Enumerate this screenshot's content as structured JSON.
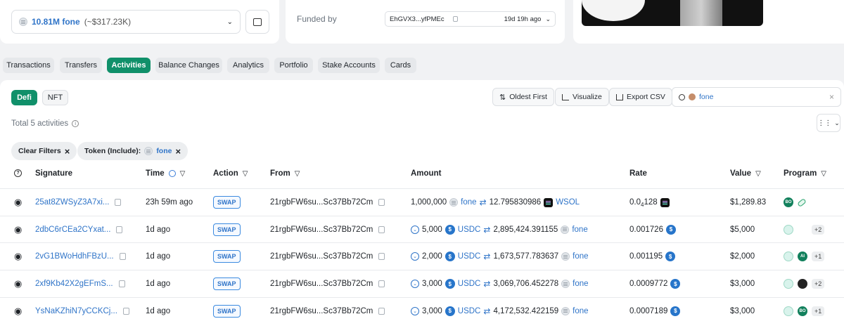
{
  "header": {
    "balance_amount": "10.81M fone",
    "balance_usd": "(~$317.23K)",
    "funded_by_label": "Funded by",
    "funded_by_address": "EhGVX3...yfPMEc",
    "funded_by_time": "19d 19h ago"
  },
  "tabs": [
    "Transactions",
    "Transfers",
    "Activities",
    "Balance Changes",
    "Analytics",
    "Portfolio",
    "Stake Accounts",
    "Cards"
  ],
  "subtabs": [
    "Defi",
    "NFT"
  ],
  "toolbar": {
    "oldest_first": "Oldest First",
    "visualize": "Visualize",
    "export_csv": "Export CSV",
    "search_value": "fone"
  },
  "summary": {
    "total": "Total 5 activities"
  },
  "filters": {
    "clear": "Clear Filters",
    "token_label": "Token (Include):",
    "token_value": "fone"
  },
  "columns": {
    "signature": "Signature",
    "time": "Time",
    "action": "Action",
    "from": "From",
    "amount": "Amount",
    "rate": "Rate",
    "value": "Value",
    "program": "Program"
  },
  "rows": [
    {
      "signature": "25at8ZWSyZ3A7xi...",
      "time": "23h 59m ago",
      "action": "SWAP",
      "from": "21rgbFW6su...Sc37Bb72Cm",
      "in_amount": "1,000,000",
      "in_token": "fone",
      "out_amount": "12.795830986",
      "out_token": "WSOL",
      "rate_main": "0.0",
      "rate_sub": "4",
      "rate_rest": "128",
      "value": "$1,289.83",
      "extra": "",
      "type": "sell"
    },
    {
      "signature": "2dbC6rCEa2CYxat...",
      "time": "1d ago",
      "action": "SWAP",
      "from": "21rgbFW6su...Sc37Bb72Cm",
      "in_amount": "5,000",
      "in_token": "USDC",
      "out_amount": "2,895,424.391155",
      "out_token": "fone",
      "rate_main": "0.001726",
      "rate_sub": "",
      "rate_rest": "",
      "value": "$5,000",
      "extra": "+2",
      "type": "buy"
    },
    {
      "signature": "2vG1BWoHdhFBzU...",
      "time": "1d ago",
      "action": "SWAP",
      "from": "21rgbFW6su...Sc37Bb72Cm",
      "in_amount": "2,000",
      "in_token": "USDC",
      "out_amount": "1,673,577.783637",
      "out_token": "fone",
      "rate_main": "0.001195",
      "rate_sub": "",
      "rate_rest": "",
      "value": "$2,000",
      "extra": "+1",
      "type": "buy"
    },
    {
      "signature": "2xf9Kb42X2gEFmS...",
      "time": "1d ago",
      "action": "SWAP",
      "from": "21rgbFW6su...Sc37Bb72Cm",
      "in_amount": "3,000",
      "in_token": "USDC",
      "out_amount": "3,069,706.452278",
      "out_token": "fone",
      "rate_main": "0.0009772",
      "rate_sub": "",
      "rate_rest": "",
      "value": "$3,000",
      "extra": "+2",
      "type": "buy"
    },
    {
      "signature": "YsNaKZhiN7yCCKCj...",
      "time": "1d ago",
      "action": "SWAP",
      "from": "21rgbFW6su...Sc37Bb72Cm",
      "in_amount": "3,000",
      "in_token": "USDC",
      "out_amount": "4,172,532.422159",
      "out_token": "fone",
      "rate_main": "0.0007189",
      "rate_sub": "",
      "rate_rest": "",
      "value": "$3,000",
      "extra": "+1",
      "type": "buy"
    }
  ],
  "program_badges": [
    [
      "BO",
      "pill"
    ],
    [
      "wave",
      "fox",
      "+2"
    ],
    [
      "wave",
      "AI",
      "+1"
    ],
    [
      "wave",
      "dark",
      "+2"
    ],
    [
      "wave",
      "BO",
      "+1"
    ]
  ],
  "colors": {
    "accent": "#10906a",
    "link": "#2f74c8",
    "usdc": "#2775ca"
  }
}
